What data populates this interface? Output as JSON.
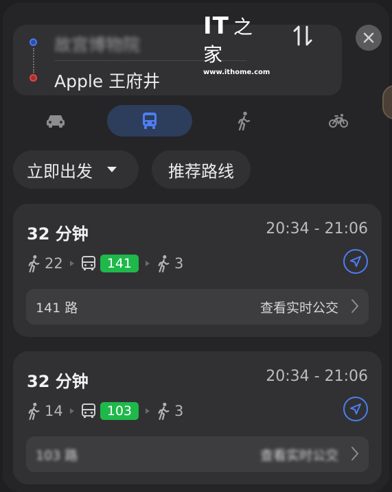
{
  "route": {
    "origin": "故宫博物院",
    "destination": "Apple 王府井"
  },
  "watermark": {
    "logo": "IT",
    "logo_cn": "之家",
    "url": "www.ithome.com"
  },
  "modes": [
    {
      "name": "drive",
      "icon": "car-icon",
      "active": false
    },
    {
      "name": "transit",
      "icon": "bus-icon",
      "active": true
    },
    {
      "name": "walk",
      "icon": "walk-icon",
      "active": false
    },
    {
      "name": "bike",
      "icon": "bike-icon",
      "active": false
    }
  ],
  "filters": {
    "depart": "立即出发",
    "sort": "推荐路线"
  },
  "routes": [
    {
      "duration": "32 分钟",
      "time_range": "20:34 - 21:06",
      "walk_before": "22",
      "bus_line": "141",
      "walk_after": "3",
      "line_name": "141 路",
      "realtime_label": "查看实时公交"
    },
    {
      "duration": "32 分钟",
      "time_range": "20:34 - 21:06",
      "walk_before": "14",
      "bus_line": "103",
      "walk_after": "3",
      "line_name": "103 路",
      "realtime_label": "查看实时公交"
    }
  ],
  "colors": {
    "accent_blue": "#4d7ef2",
    "bus_green": "#1fb84a",
    "origin_dot": "#4a78f0",
    "destination_dot": "#e04848"
  }
}
